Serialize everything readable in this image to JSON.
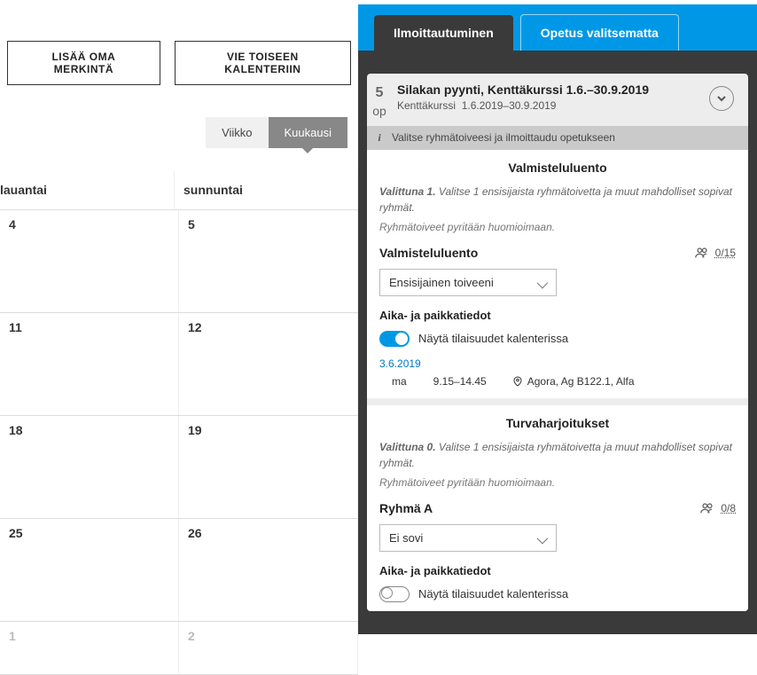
{
  "buttons": {
    "add_own": "LISÄÄ OMA MERKINTÄ",
    "export": "VIE TOISEEN KALENTERIIN"
  },
  "view": {
    "week": "Viikko",
    "month": "Kuukausi"
  },
  "calendar": {
    "day_sat": "lauantai",
    "day_sun": "sunnuntai",
    "rows": [
      {
        "a": "4",
        "b": "5",
        "dim": false
      },
      {
        "a": "11",
        "b": "12",
        "dim": false
      },
      {
        "a": "18",
        "b": "19",
        "dim": false
      },
      {
        "a": "25",
        "b": "26",
        "dim": false
      },
      {
        "a": "1",
        "b": "2",
        "dim": true
      }
    ]
  },
  "tabs": {
    "active": "Ilmoittautuminen",
    "inactive": "Opetus valitsematta"
  },
  "course": {
    "credits": "5",
    "credits_unit": "op",
    "title": "Silakan pyynti, Kenttäkurssi 1.6.–30.9.2019",
    "subtitle_name": "Kenttäkurssi",
    "subtitle_dates": "1.6.2019–30.9.2019",
    "info": "Valitse ryhmätoiveesi ja ilmoittaudu opetukseen"
  },
  "sec1": {
    "title": "Valmisteluluento",
    "selected_label": "Valittuna 1.",
    "selected_rest": " Valitse 1 ensisijaista ryhmätoivetta ja muut mahdolliset sopivat ryhmät.",
    "note": "Ryhmätoiveet pyritään huomioimaan.",
    "group": "Valmisteluluento",
    "capacity": "0/15",
    "select": "Ensisijainen toiveeni",
    "timeplace": "Aika- ja paikkatiedot",
    "toggle_label": "Näytä tilaisuudet kalenterissa",
    "date": "3.6.2019",
    "day": "ma",
    "time": "9.15–14.45",
    "location": "Agora, Ag B122.1, Alfa"
  },
  "sec2": {
    "title": "Turvaharjoitukset",
    "selected_label": "Valittuna 0.",
    "selected_rest": " Valitse 1 ensisijaista ryhmätoivetta ja muut mahdolliset sopivat ryhmät.",
    "note": "Ryhmätoiveet pyritään huomioimaan.",
    "group": "Ryhmä A",
    "capacity": "0/8",
    "select": "Ei sovi",
    "timeplace": "Aika- ja paikkatiedot",
    "toggle_label": "Näytä tilaisuudet kalenterissa"
  }
}
